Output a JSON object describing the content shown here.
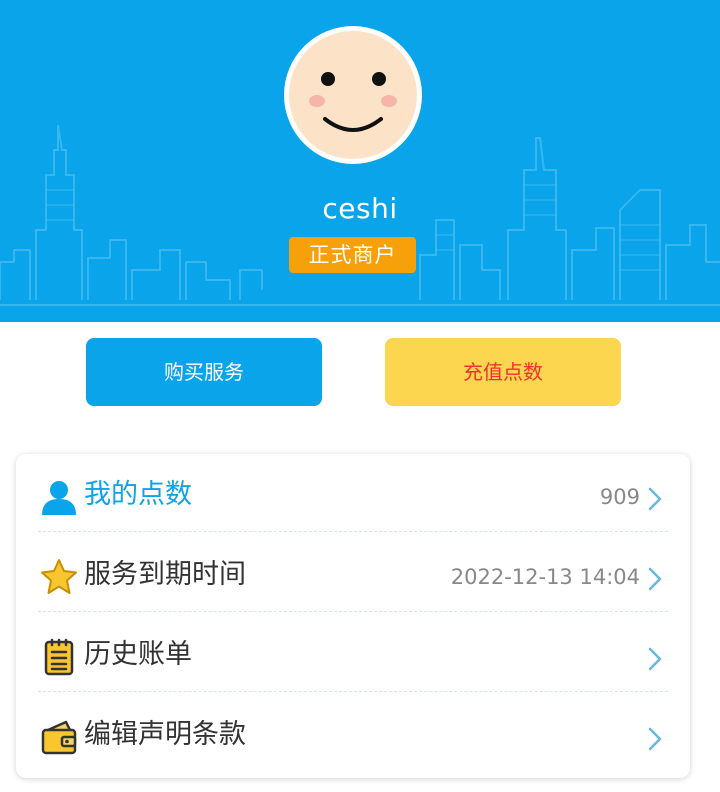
{
  "profile": {
    "username": "ceshi",
    "badge": "正式商户"
  },
  "actions": {
    "buy_label": "购买服务",
    "recharge_label": "充值点数"
  },
  "menu": [
    {
      "icon": "person-icon",
      "label": "我的点数",
      "value": "909"
    },
    {
      "icon": "star-icon",
      "label": "服务到期时间",
      "value": "2022-12-13 14:04"
    },
    {
      "icon": "notepad-icon",
      "label": "历史账单",
      "value": ""
    },
    {
      "icon": "wallet-icon",
      "label": "编辑声明条款",
      "value": ""
    }
  ],
  "colors": {
    "primary": "#0aa4ea",
    "badge": "#f7a10a",
    "recharge_bg": "#fbd64e",
    "recharge_text": "#f0322d"
  }
}
